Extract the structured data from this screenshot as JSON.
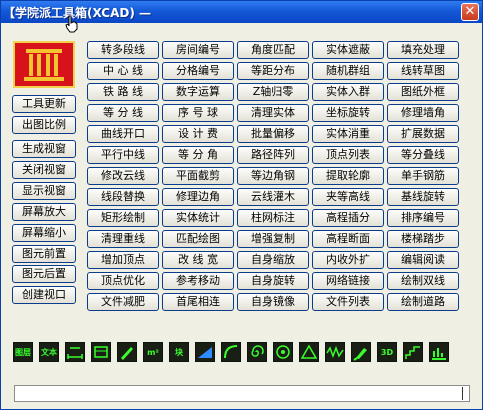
{
  "window": {
    "title": "【学院派工具箱(XCAD) —"
  },
  "left_buttons": [
    "工具更新",
    "出图比例",
    "生成视窗",
    "关闭视窗",
    "显示视窗",
    "屏幕放大",
    "屏幕缩小",
    "图元前置",
    "图元后置",
    "创建视口"
  ],
  "grid_rows": [
    [
      "转多段线",
      "房间编号",
      "角度匹配",
      "实体遮蔽",
      "填充处理"
    ],
    [
      "中 心 线",
      "分格编号",
      "等距分布",
      "随机群组",
      "线转草图"
    ],
    [
      "铁 路 线",
      "数字运算",
      "Z轴归零",
      "实体入群",
      "图纸外框"
    ],
    [
      "等 分 线",
      "序 号 球",
      "清理实体",
      "坐标旋转",
      "修理墙角"
    ],
    [
      "曲线开口",
      "设 计 费",
      "批量偏移",
      "实体消重",
      "扩展数据"
    ],
    [
      "平行中线",
      "等 分 角",
      "路径阵列",
      "顶点列表",
      "等分叠线"
    ],
    [
      "修改云线",
      "平面截剪",
      "等边角钢",
      "提取轮廓",
      "单手钢筋"
    ],
    [
      "线段替换",
      "修理边角",
      "云线灌木",
      "夹等高线",
      "基线旋转"
    ],
    [
      "矩形绘制",
      "实体统计",
      "柱网标注",
      "高程插分",
      "排序编号"
    ],
    [
      "清理重线",
      "匹配绘图",
      "增强复制",
      "高程断面",
      "楼梯踏步"
    ],
    [
      "增加顶点",
      "改 线 宽",
      "自身缩放",
      "内收外扩",
      "编辑阅读"
    ],
    [
      "顶点优化",
      "参考移动",
      "自身旋转",
      "网络链接",
      "绘制双线"
    ],
    [
      "文件减肥",
      "首尾相连",
      "自身镜像",
      "文件列表",
      "绘制道路"
    ]
  ],
  "toolbar": {
    "labels": [
      "图层",
      "文本",
      "",
      "",
      "",
      "m²",
      "块",
      "",
      "",
      "",
      "",
      "",
      "",
      "",
      "3D",
      "",
      ""
    ],
    "icon_names": [
      "layer-tool-icon",
      "text-tool-icon",
      "dimension-tool-icon",
      "window-tool-icon",
      "pen-tool-icon",
      "area-tool-icon",
      "block-tool-icon",
      "slope-tool-icon",
      "curve-tool-icon",
      "spiral-tool-icon",
      "circle-tool-icon",
      "triangle-tool-icon",
      "wave-tool-icon",
      "brush-tool-icon",
      "3d-tool-icon",
      "stair-tool-icon",
      "chart-tool-icon"
    ]
  },
  "colors": {
    "accent": "#0b3c8c",
    "icon_green": "#38ff2c",
    "logo_red": "#d8121b"
  }
}
